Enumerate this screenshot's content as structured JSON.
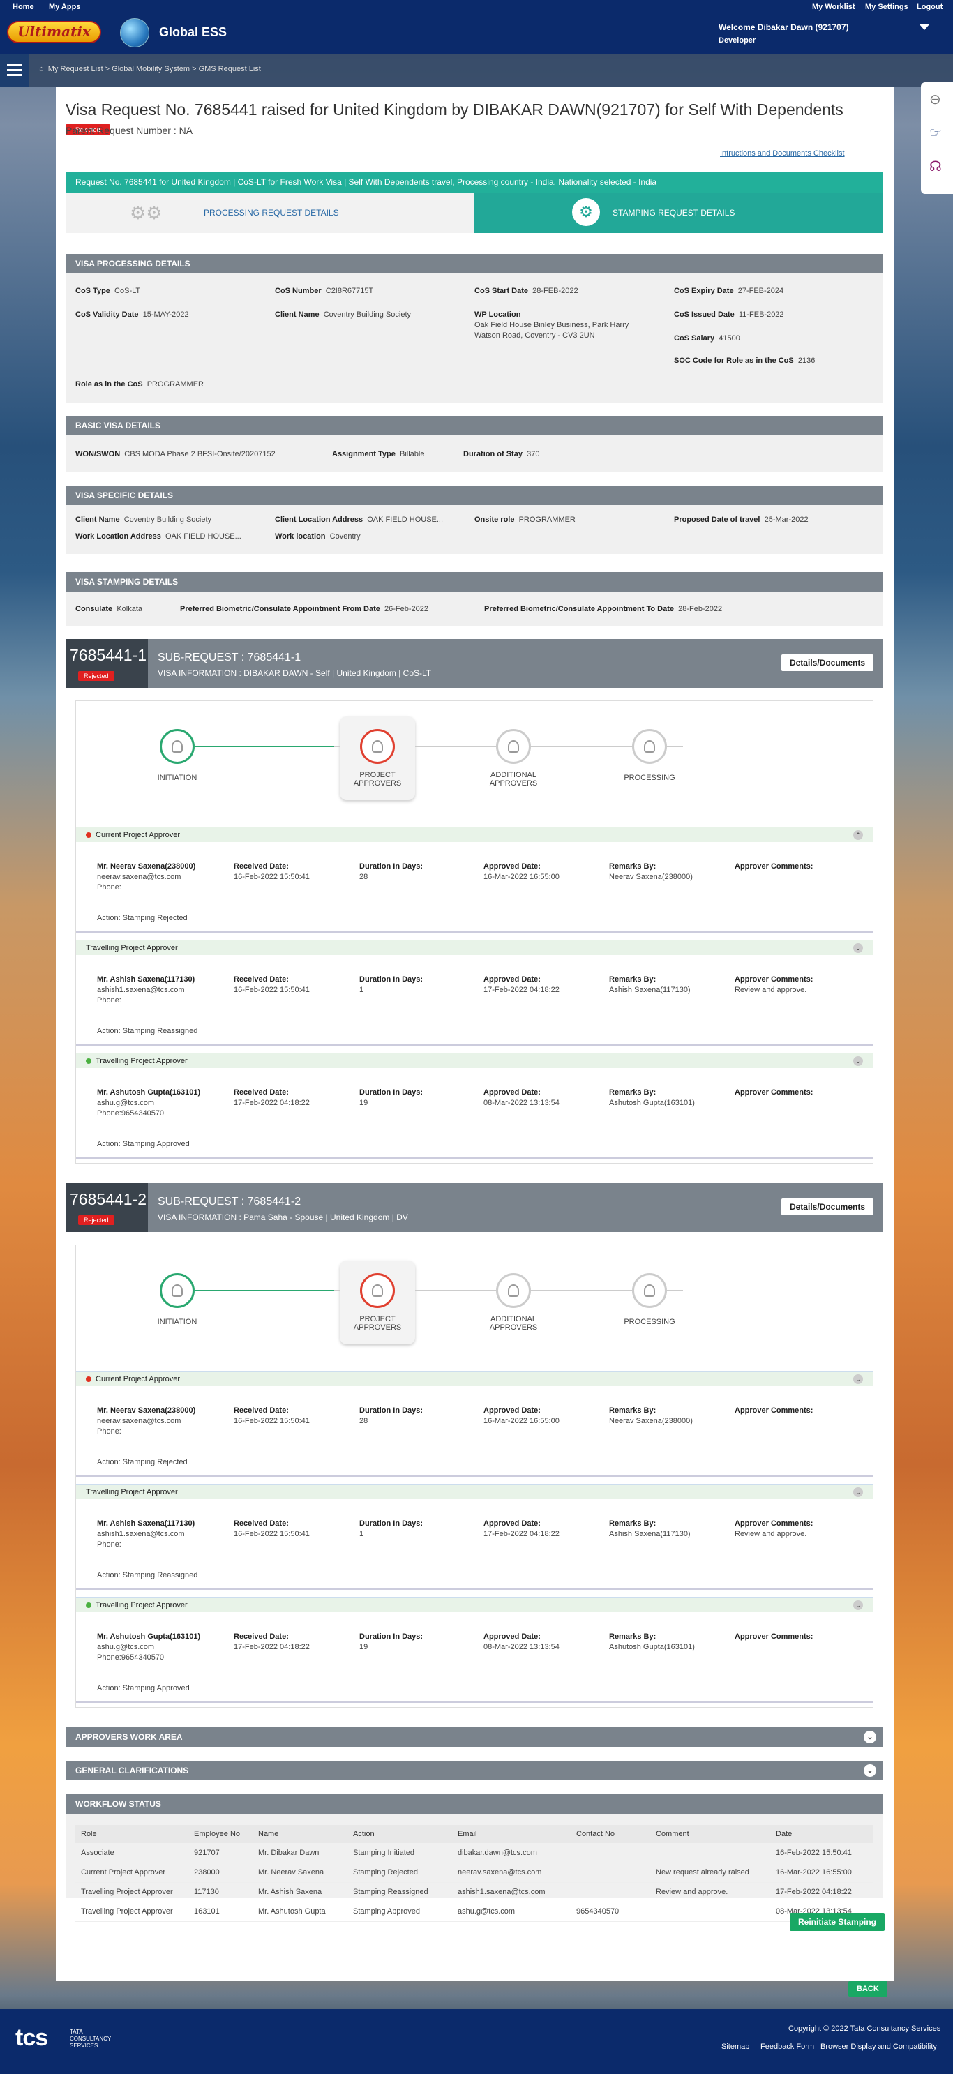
{
  "header": {
    "links": [
      "Home",
      "My Apps"
    ],
    "right_links": [
      "My Worklist",
      "My Settings",
      "Logout"
    ],
    "logo": "Ultimatix",
    "app_name": "Global ESS",
    "welcome": "Welcome Dibakar Dawn (921707)",
    "role": "Developer"
  },
  "breadcrumb": "My Request List > Global Mobility System > GMS Request List",
  "page": {
    "title": "Visa Request No. 7685441 raised for United Kingdom by DIBAKAR DAWN(921707) for Self With Dependents",
    "status": "Rejected",
    "parent": "Parent Request Number : NA",
    "instructions_link": "Intructions and Documents Checklist",
    "banner": "Request No. 7685441 for United Kingdom | CoS-LT for Fresh Work Visa | Self With Dependents travel, Processing country - India, Nationality selected - India",
    "tabs": [
      "PROCESSING REQUEST DETAILS",
      "STAMPING REQUEST DETAILS"
    ]
  },
  "visa_processing": {
    "title": "VISA PROCESSING DETAILS",
    "cos_type_l": "CoS Type",
    "cos_type": "CoS-LT",
    "cos_number_l": "CoS Number",
    "cos_number": "C2I8R67715T",
    "cos_start_l": "CoS Start Date",
    "cos_start": "28-FEB-2022",
    "cos_expiry_l": "CoS Expiry Date",
    "cos_expiry": "27-FEB-2024",
    "cos_validity_l": "CoS Validity Date",
    "cos_validity": "15-MAY-2022",
    "client_l": "Client Name",
    "client": "Coventry Building Society",
    "wp_l": "WP Location",
    "wp1": "Oak Field House Binley Business, Park Harry",
    "wp2": "Watson Road, Coventry - CV3 2UN",
    "cos_issued_l": "CoS Issued Date",
    "cos_issued": "11-FEB-2022",
    "salary_l": "CoS Salary",
    "salary": "41500",
    "soc_l": "SOC Code for Role as in the CoS",
    "soc": "2136",
    "role_l": "Role as in the CoS",
    "role": "PROGRAMMER"
  },
  "basic_visa": {
    "title": "BASIC VISA DETAILS",
    "won_l": "WON/SWON",
    "won": "CBS MODA Phase 2 BFSI-Onsite/20207152",
    "assign_l": "Assignment Type",
    "assign": "Billable",
    "dur_l": "Duration of Stay",
    "dur": "370"
  },
  "visa_specific": {
    "title": "VISA SPECIFIC DETAILS",
    "client_l": "Client Name",
    "client": "Coventry Building Society",
    "cla_l": "Client Location Address",
    "cla": "OAK FIELD HOUSE...",
    "onsite_l": "Onsite role",
    "onsite": "PROGRAMMER",
    "pdt_l": "Proposed Date of travel",
    "pdt": "25-Mar-2022",
    "wla_l": "Work Location Address",
    "wla": "OAK FIELD HOUSE...",
    "wl_l": "Work location",
    "wl": "Coventry"
  },
  "visa_stamping": {
    "title": "VISA STAMPING DETAILS",
    "cons_l": "Consulate",
    "cons": "Kolkata",
    "from_l": "Preferred Biometric/Consulate Appointment From Date",
    "from": "26-Feb-2022",
    "to_l": "Preferred Biometric/Consulate Appointment To Date",
    "to": "28-Feb-2022"
  },
  "steps": [
    "INITIATION",
    "PROJECT APPROVERS",
    "ADDITIONAL APPROVERS",
    "PROCESSING"
  ],
  "labels": {
    "received": "Received Date:",
    "duration": "Duration In Days:",
    "approved": "Approved Date:",
    "remarks": "Remarks By:",
    "comments": "Approver Comments:",
    "details_btn": "Details/Documents"
  },
  "subrequests": [
    {
      "id": "7685441-1",
      "status": "Rejected",
      "title": "SUB-REQUEST : 7685441-1",
      "info": "VISA INFORMATION : DIBAKAR DAWN - Self | United Kingdom | CoS-LT",
      "approvers": [
        {
          "head": "Current Project Approver",
          "name": "Mr. Neerav Saxena(238000)",
          "email": "neerav.saxena@tcs.com",
          "phone": "Phone:",
          "received": "16-Feb-2022 15:50:41",
          "duration": "28",
          "approved": "16-Mar-2022 16:55:00",
          "remarks": "Neerav Saxena(238000)",
          "comment": "",
          "action": "Action: Stamping Rejected"
        },
        {
          "head": "Travelling Project Approver",
          "name": "Mr. Ashish Saxena(117130)",
          "email": "ashish1.saxena@tcs.com",
          "phone": "Phone:",
          "received": "16-Feb-2022 15:50:41",
          "duration": "1",
          "approved": "17-Feb-2022 04:18:22",
          "remarks": "Ashish Saxena(117130)",
          "comment": "Review and approve.",
          "action": "Action: Stamping Reassigned"
        },
        {
          "head": "Travelling Project Approver",
          "name": "Mr. Ashutosh Gupta(163101)",
          "email": "ashu.g@tcs.com",
          "phone": "Phone:9654340570",
          "received": "17-Feb-2022 04:18:22",
          "duration": "19",
          "approved": "08-Mar-2022 13:13:54",
          "remarks": "Ashutosh Gupta(163101)",
          "comment": "",
          "action": "Action: Stamping Approved"
        }
      ]
    },
    {
      "id": "7685441-2",
      "status": "Rejected",
      "title": "SUB-REQUEST : 7685441-2",
      "info": "VISA INFORMATION : Pama Saha - Spouse | United Kingdom | DV",
      "approvers": [
        {
          "head": "Current Project Approver",
          "name": "Mr. Neerav Saxena(238000)",
          "email": "neerav.saxena@tcs.com",
          "phone": "Phone:",
          "received": "16-Feb-2022 15:50:41",
          "duration": "28",
          "approved": "16-Mar-2022 16:55:00",
          "remarks": "Neerav Saxena(238000)",
          "comment": "",
          "action": "Action: Stamping Rejected"
        },
        {
          "head": "Travelling Project Approver",
          "name": "Mr. Ashish Saxena(117130)",
          "email": "ashish1.saxena@tcs.com",
          "phone": "Phone:",
          "received": "16-Feb-2022 15:50:41",
          "duration": "1",
          "approved": "17-Feb-2022 04:18:22",
          "remarks": "Ashish Saxena(117130)",
          "comment": "Review and approve.",
          "action": "Action: Stamping Reassigned"
        },
        {
          "head": "Travelling Project Approver",
          "name": "Mr. Ashutosh Gupta(163101)",
          "email": "ashu.g@tcs.com",
          "phone": "Phone:9654340570",
          "received": "17-Feb-2022 04:18:22",
          "duration": "19",
          "approved": "08-Mar-2022 13:13:54",
          "remarks": "Ashutosh Gupta(163101)",
          "comment": "",
          "action": "Action: Stamping Approved"
        }
      ]
    }
  ],
  "bars": [
    "APPROVERS WORK AREA",
    "GENERAL CLARIFICATIONS",
    "WORKFLOW STATUS"
  ],
  "workflow": {
    "columns": [
      "Role",
      "Employee No",
      "Name",
      "Action",
      "Email",
      "Contact No",
      "Comment",
      "Date"
    ],
    "rows": [
      [
        "Associate",
        "921707",
        "Mr. Dibakar Dawn",
        "Stamping Initiated",
        "dibakar.dawn@tcs.com",
        "",
        "",
        "16-Feb-2022 15:50:41"
      ],
      [
        "Current Project Approver",
        "238000",
        "Mr. Neerav Saxena",
        "Stamping Rejected",
        "neerav.saxena@tcs.com",
        "",
        "New request already raised",
        "16-Mar-2022 16:55:00"
      ],
      [
        "Travelling Project Approver",
        "117130",
        "Mr. Ashish Saxena",
        "Stamping Reassigned",
        "ashish1.saxena@tcs.com",
        "",
        "Review and approve.",
        "17-Feb-2022 04:18:22"
      ],
      [
        "Travelling Project Approver",
        "163101",
        "Mr. Ashutosh Gupta",
        "Stamping Approved",
        "ashu.g@tcs.com",
        "9654340570",
        "",
        "08-Mar-2022 13:13:54"
      ]
    ]
  },
  "buttons": {
    "reinitiate": "Reinitiate Stamping",
    "back": "BACK"
  },
  "footer": {
    "brand": "tcs",
    "company": "TATA CONSULTANCY SERVICES",
    "copyright": "Copyright © 2022 Tata Consultancy Services",
    "links": [
      "Sitemap",
      "Feedback Form",
      "Browser Display and Compatibility"
    ]
  }
}
